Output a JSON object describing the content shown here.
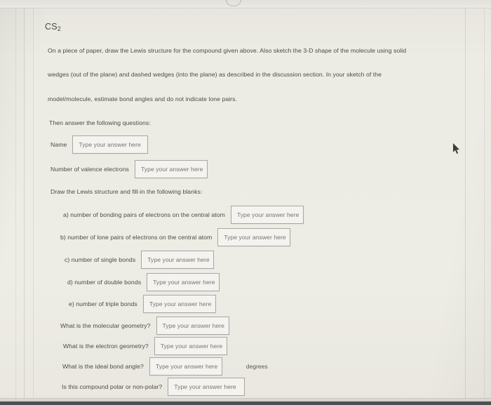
{
  "document": {
    "title_text": "CS",
    "title_subscript": "2",
    "paragraphs": [
      "On a piece of paper, draw the Lewis structure for the compound given above.  Also sketch the 3-D shape of the molecule using solid",
      "wedges (out of the plane) and dashed wedges (into the plane) as described in the discussion section.  In your sketch of the",
      "model/molecule, estimate bond angles and do not indicate lone pairs.",
      "Then answer the following questions:"
    ],
    "blanks_intro": "Draw the Lewis structure and fill-in the following blanks:",
    "placeholder": "Type your answer here",
    "fields": [
      {
        "label": "Name",
        "value": ""
      },
      {
        "label": "Number of valence electrons",
        "value": ""
      },
      {
        "label": "a) number of bonding pairs of electrons on the central atom",
        "value": ""
      },
      {
        "label": "b) number of lone pairs of electrons on the central atom",
        "value": ""
      },
      {
        "label": "c) number of single bonds",
        "value": ""
      },
      {
        "label": "d) number of double bonds",
        "value": ""
      },
      {
        "label": "e) number of triple bonds",
        "value": ""
      },
      {
        "label": "What is the molecular geometry?",
        "value": ""
      },
      {
        "label": "What is the electron geometry?",
        "value": ""
      },
      {
        "label": "What is the ideal bond angle?",
        "value": "",
        "suffix": "degrees"
      },
      {
        "label": "Is this compound polar or non-polar?",
        "value": ""
      }
    ]
  },
  "colors": {
    "page_background": "#eceae3",
    "text": "#4c4b47",
    "field_border": "#a9a7a0",
    "placeholder_text": "#77756f",
    "bottom_bar": "#4c4f55"
  }
}
